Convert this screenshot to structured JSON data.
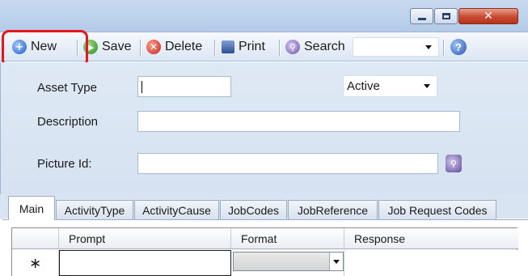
{
  "window": {
    "min_label": "",
    "max_label": "",
    "close_label": "✕"
  },
  "toolbar": {
    "new_label": "New",
    "save_label": "Save",
    "delete_label": "Delete",
    "print_label": "Print",
    "search_label": "Search",
    "dropdown_value": "",
    "help_label": "?"
  },
  "form": {
    "asset_type_label": "Asset Type",
    "asset_type_value": "",
    "status_value": "Active",
    "description_label": "Description",
    "description_value": "",
    "picture_id_label": "Picture Id:",
    "picture_id_value": ""
  },
  "tabs": [
    {
      "label": "Main",
      "active": true
    },
    {
      "label": "ActivityType",
      "active": false
    },
    {
      "label": "ActivityCause",
      "active": false
    },
    {
      "label": "JobCodes",
      "active": false
    },
    {
      "label": "JobReference",
      "active": false
    },
    {
      "label": "Job Request Codes",
      "active": false
    }
  ],
  "grid": {
    "columns": [
      "Prompt",
      "Format",
      "Response"
    ],
    "new_row_marker": "∗",
    "rows": [
      {
        "prompt": "",
        "format": "",
        "response": ""
      }
    ]
  },
  "colors": {
    "highlight": "#e8151d",
    "form_background": "#dfe9f5",
    "toolbar_background": "#dbe6f4"
  }
}
